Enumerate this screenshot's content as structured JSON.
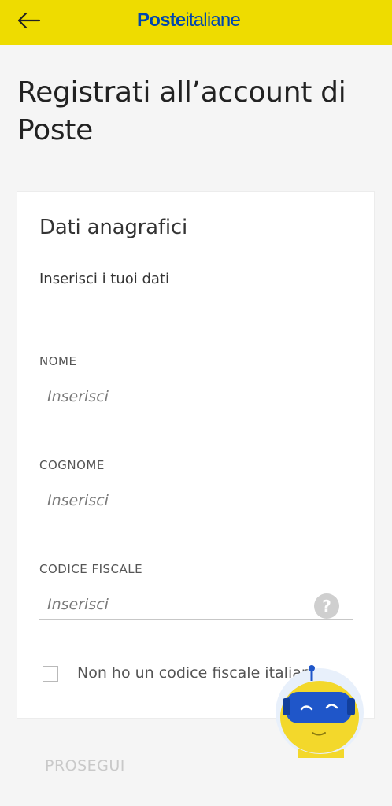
{
  "header": {
    "back_icon": "arrow-left-icon",
    "logo_bold": "Poste",
    "logo_light": "italiane",
    "bg_color": "#eedc00",
    "logo_color": "#0046ad"
  },
  "page": {
    "title": "Registrati all’account di Poste"
  },
  "card": {
    "title": "Dati anagrafici",
    "subtitle": "Inserisci i tuoi dati",
    "fields": [
      {
        "label": "NOME",
        "placeholder": "Inserisci"
      },
      {
        "label": "COGNOME",
        "placeholder": "Inserisci"
      },
      {
        "label": "CODICE FISCALE",
        "placeholder": "Inserisci",
        "help_icon": "question-mark-icon",
        "help_glyph": "?"
      }
    ],
    "checkbox_label": "Non ho un codice fiscale italiano"
  },
  "footer": {
    "continue_label": "PROSEGUI"
  },
  "assistant": {
    "icon": "robot-assistant-icon"
  }
}
